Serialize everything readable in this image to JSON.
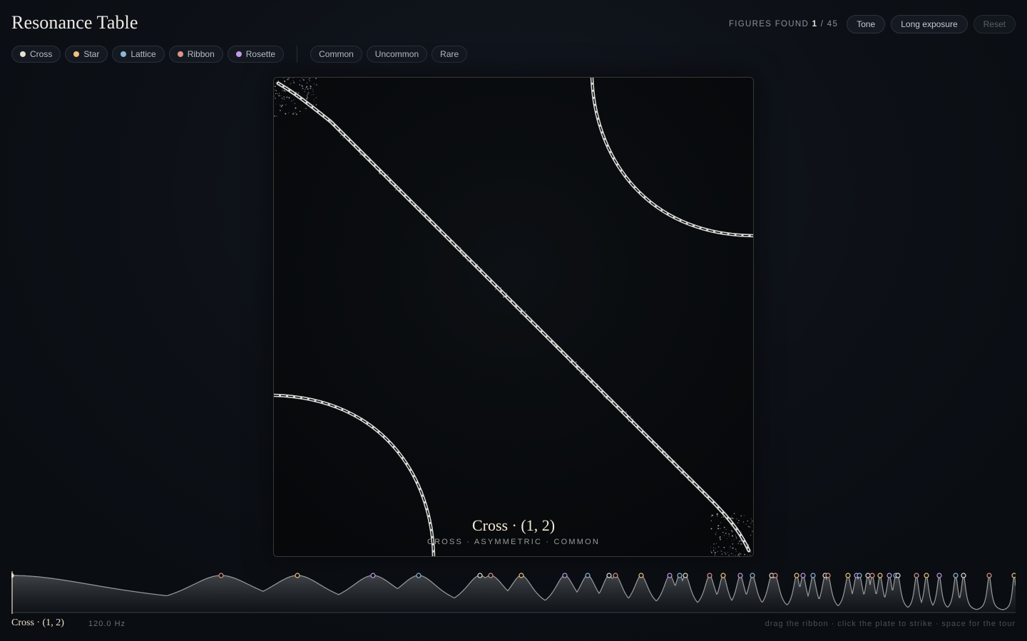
{
  "app": {
    "title": "Resonance Table"
  },
  "counter": {
    "label": "FIGURES FOUND",
    "found": "1",
    "separator": "/",
    "total": "45"
  },
  "buttons": {
    "tone": "Tone",
    "long_exposure": "Long exposure",
    "reset": "Reset"
  },
  "families": [
    {
      "label": "Cross",
      "color": "#e6ded0"
    },
    {
      "label": "Star",
      "color": "#f2c27a"
    },
    {
      "label": "Lattice",
      "color": "#8fb7d6"
    },
    {
      "label": "Ribbon",
      "color": "#de948a"
    },
    {
      "label": "Rosette",
      "color": "#c39ae4"
    }
  ],
  "rarities": [
    {
      "label": "Common"
    },
    {
      "label": "Uncommon"
    },
    {
      "label": "Rare"
    }
  ],
  "plate": {
    "name": "Cross · (1, 2)",
    "subtitle": "CROSS · ASYMMETRIC · COMMON",
    "line_color": "#d9d9d6"
  },
  "status": {
    "current": "Cross · (1, 2)",
    "frequency": "120.0 Hz"
  },
  "hint": "drag the ribbon · click the plate to strike · space for the tour"
}
